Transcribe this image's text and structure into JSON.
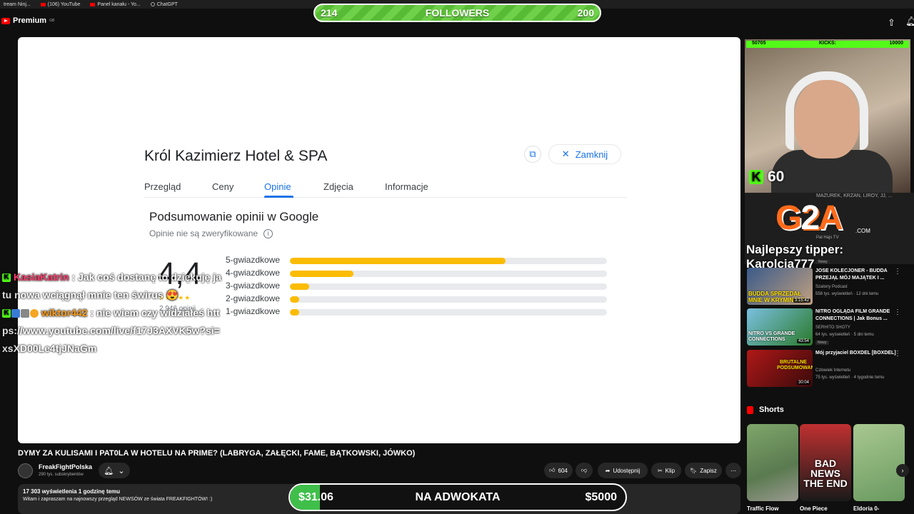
{
  "bookmarks": [
    {
      "label": "tream Ninj...",
      "icon": "page-icon"
    },
    {
      "label": "(106) YouTube",
      "icon": "youtube-icon"
    },
    {
      "label": "Panel kanału - Yo...",
      "icon": "youtube-icon"
    },
    {
      "label": "ChatGPT",
      "icon": "chatgpt-icon"
    }
  ],
  "header": {
    "logo": "Premium",
    "logo_sup": "GB"
  },
  "followers_goal": {
    "current": "214",
    "label": "FOLLOWERS",
    "target": "200"
  },
  "google_panel": {
    "hotel_name": "Król Kazimierz Hotel & SPA",
    "close_label": "Zamknij",
    "tabs": [
      "Przegląd",
      "Ceny",
      "Opinie",
      "Zdjęcia",
      "Informacje"
    ],
    "active_tab": "Opinie",
    "summary_title": "Podsumowanie opinii w Google",
    "unverified_note": "Opinie nie są zweryfikowane",
    "rating": "4,4",
    "stars": "★★★★★",
    "reviews_count": "2 946 opinii",
    "distribution": [
      {
        "label": "5-gwiazdkowe",
        "fraction": 0.68
      },
      {
        "label": "4-gwiazdkowe",
        "fraction": 0.2
      },
      {
        "label": "3-gwiazdkowe",
        "fraction": 0.06
      },
      {
        "label": "2-gwiazdkowe",
        "fraction": 0.03
      },
      {
        "label": "1-gwiazdkowe",
        "fraction": 0.03
      }
    ]
  },
  "chat": [
    {
      "user": "KasiaKatrin",
      "text": ": Jak coś dostanę to dziękuję ja tu nowa wciągnął mnie ten świrus",
      "emoji": "😍"
    },
    {
      "user": "wiktor442",
      "text": ": nie wiem czy widziałeś https://www.youtube.com/live/f17J3AXVK5w?si=xsXD00Le4tjJNaGm"
    }
  ],
  "video": {
    "title": "DYMY ZA KULISAMI I PAT0LA W HOTELU NA PRIME? (LABRYGA, ZAŁĘCKI, FAME, BĄTKOWSKI, JÓWKO)",
    "channel_name": "FreakFightPolska",
    "channel_subs": "290 tys. subskrybentów",
    "likes": "604",
    "share_label": "Udostępnij",
    "clip_label": "Klip",
    "save_label": "Zapisz",
    "views_line": "17 303 wyświetlenia  1 godzinę temu",
    "description": "Witam i zapraszam na najnowszy przegląd NEWSÓW ze świata FREAKFIGHTÓW! :)"
  },
  "donation_goal": {
    "current": "$31.06",
    "title": "NA ADWOKATA",
    "target": "$5000",
    "progress": 0.0062
  },
  "kicks": {
    "left": "50705",
    "label": "KICKS:",
    "right": "10000",
    "count": "60"
  },
  "sponsor": {
    "brand_g": "G",
    "brand_2": "2",
    "brand_a": "A",
    "brand_com": ".COM",
    "top_line": "MAZUREK, KRZAN, LIROY, JJ, ...",
    "pre_meta": "Pal Hajs TV"
  },
  "tipper": "Najlepszy tipper: Karolcia777",
  "recommendations": [
    {
      "title": "JOSE KOLECJONER - BUDDA PRZEJĄŁ MÓJ MAJĄTEK I ...",
      "channel": "Szalony Podcast",
      "meta": "558 tys. wyświetleń · 12 dni temu",
      "duration": "3:15:42",
      "thumb_text": "BUDDA SPRZEDAŁ MNIE W KRYMINALE",
      "badge": ""
    },
    {
      "title": "NITRO OGLĄDA FILM GRANDE CONNECTIONS | Jak Bonus ...",
      "channel": "SERHITO SHOTY",
      "meta": "64 tys. wyświetleń · 5 dni temu",
      "duration": "43:54",
      "thumb_text": "NITRO VS GRANDE CONNECTIONS",
      "badge": "Nowy"
    },
    {
      "title": "Mój przyjaciel BOXDEL [BOXDEL]",
      "channel": "Człowiek Internetu",
      "meta": "75 tys. wyświetleń · 4 tygodnie temu",
      "duration": "30:04",
      "thumb_text": "BRUTALNE PODSUMOWANIE",
      "badge": ""
    }
  ],
  "pre_badge": "Nowy",
  "shorts": {
    "label": "Shorts",
    "items": [
      {
        "title": "Traffic Flow"
      },
      {
        "title": "One Piece",
        "thumb_text": "BAD NEWS THE END"
      },
      {
        "title": "Eldoria 0-"
      }
    ]
  },
  "colors": {
    "google_blue": "#1a73e8",
    "star_yellow": "#fbbc04",
    "kick_green": "#53fc18",
    "followers_green": "#58bb35"
  }
}
